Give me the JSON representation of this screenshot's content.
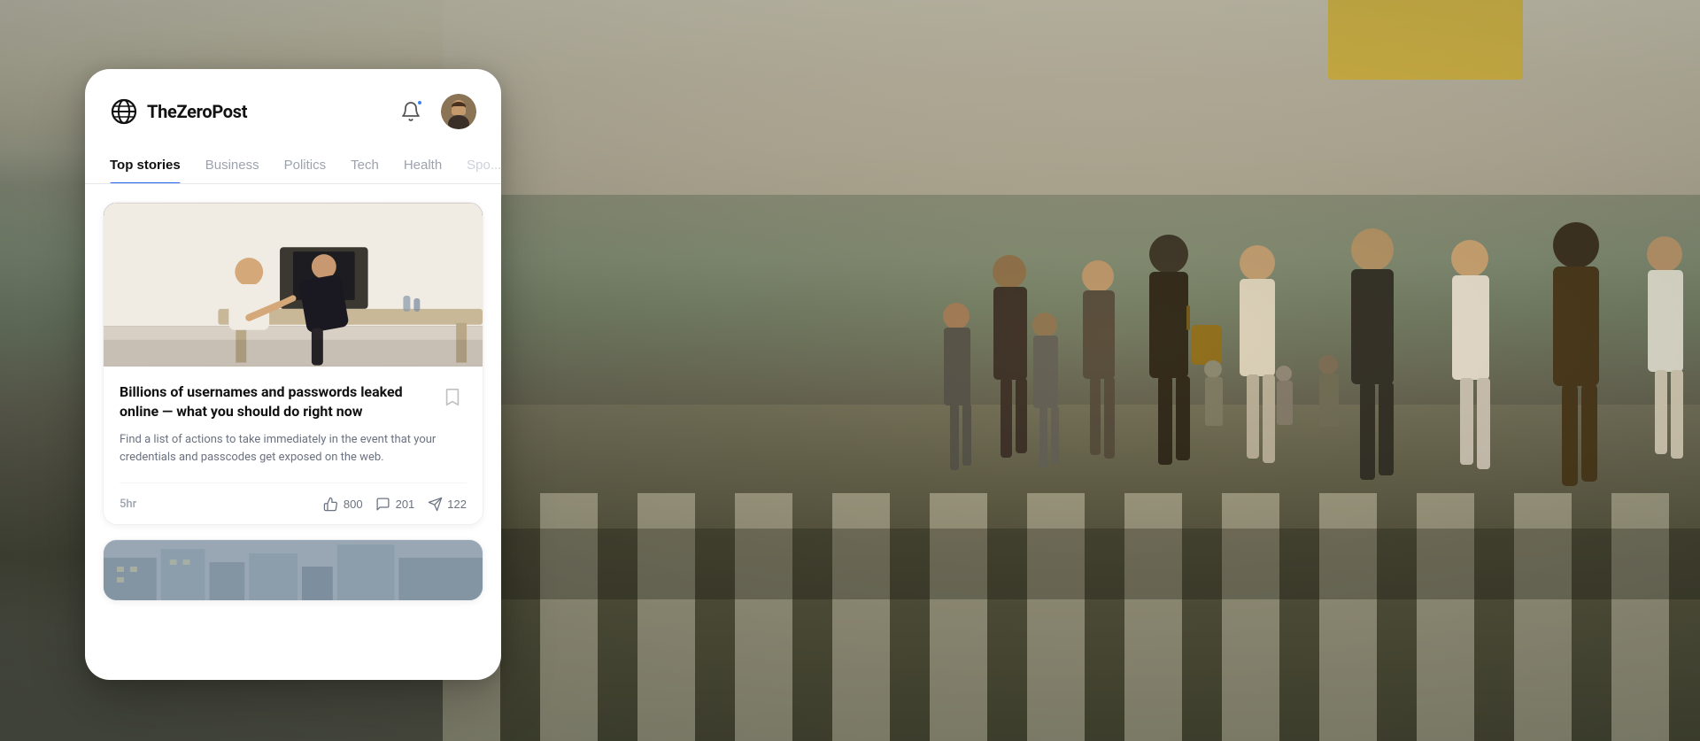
{
  "app": {
    "name": "TheZeroPost",
    "logo_alt": "globe-icon"
  },
  "header": {
    "bell_label": "notifications",
    "avatar_alt": "user-avatar"
  },
  "nav": {
    "tabs": [
      {
        "id": "top-stories",
        "label": "Top stories",
        "active": true
      },
      {
        "id": "business",
        "label": "Business",
        "active": false
      },
      {
        "id": "politics",
        "label": "Politics",
        "active": false
      },
      {
        "id": "tech",
        "label": "Tech",
        "active": false
      },
      {
        "id": "health",
        "label": "Health",
        "active": false
      },
      {
        "id": "sports",
        "label": "Spo...",
        "active": false
      }
    ]
  },
  "stories": [
    {
      "id": "story-1",
      "title": "Billions of usernames and passwords leaked online — what you should do right now",
      "excerpt": "Find a list of actions to take immediately in the event that your credentials and passcodes get exposed on the web.",
      "time": "5hr",
      "likes": "800",
      "comments": "201",
      "shares": "122",
      "bookmarked": false
    }
  ],
  "actions": {
    "like_label": "800",
    "comment_label": "201",
    "share_label": "122",
    "bookmark_label": "bookmark"
  },
  "colors": {
    "accent": "#2563eb",
    "active_tab_line": "#2563eb",
    "text_primary": "#111111",
    "text_secondary": "#6b7280",
    "text_muted": "#9ca3af"
  }
}
